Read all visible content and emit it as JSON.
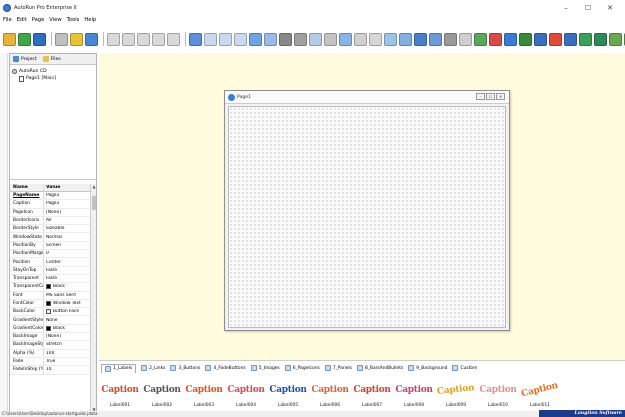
{
  "window": {
    "title": "AutoRun Pro Enterprise II",
    "minimize": "–",
    "maximize": "☐",
    "close": "✕"
  },
  "menu": [
    "File",
    "Edit",
    "Page",
    "View",
    "Tools",
    "Help"
  ],
  "toolbar_colors": [
    "#e8b33a",
    "#3fa64a",
    "#2f6fbf",
    "#bfbfbf",
    "#e8c23a",
    "#4a86d6",
    "#d9d9d9",
    "#d9d9d9",
    "#d9d9d9",
    "#d9d9d9",
    "#d9d9d9",
    "#5b8fd9",
    "#c9d9ef",
    "#c9d9ef",
    "#c9d9ef",
    "#6ea5e0",
    "#9bbbe6",
    "#888888",
    "#a0a0a0",
    "#b5c9e8",
    "#c4c4c4",
    "#8ab4e6",
    "#d0d0d0",
    "#d6d6d6",
    "#9cc5e8",
    "#7fb0e0",
    "#4a7fc8",
    "#6e9bd8",
    "#9a9a9a",
    "#cfcfcf",
    "#5ba75b",
    "#d94a4a",
    "#3b7bd6",
    "#3b8a3b",
    "#3a6fbf",
    "#e04a3a",
    "#3a6fbf",
    "#3aa05a",
    "#2e8b57",
    "#6aa84f",
    "#57a957"
  ],
  "left_panel": {
    "tabs": [
      {
        "label": "Project"
      },
      {
        "label": "Files"
      }
    ],
    "tree": {
      "root": "AutoRun CD",
      "child": "Page1 [Main]"
    }
  },
  "properties": {
    "header_name": "Name",
    "header_value": "Value",
    "rows": [
      {
        "name": "PageName",
        "value": "Page1"
      },
      {
        "name": "Caption",
        "value": "Page1"
      },
      {
        "name": "PageIcon",
        "value": "[None]"
      },
      {
        "name": "BorderIcons",
        "value": "All"
      },
      {
        "name": "BorderStyle",
        "value": "Sizeable"
      },
      {
        "name": "WindowState",
        "value": "Normal"
      },
      {
        "name": "PositionBy",
        "value": "Screen"
      },
      {
        "name": "PositionMargin",
        "value": "0"
      },
      {
        "name": "Position",
        "value": "Center"
      },
      {
        "name": "StayOnTop",
        "value": "False"
      },
      {
        "name": "Transparent",
        "value": "False"
      },
      {
        "name": "TransparentCol",
        "value": "Black"
      },
      {
        "name": "Font",
        "value": "MS Sans Serif"
      },
      {
        "name": "FontColor",
        "value": "Window Text"
      },
      {
        "name": "BackColor",
        "value": "Button Face"
      },
      {
        "name": "GradientStyle",
        "value": "None"
      },
      {
        "name": "GradientColor",
        "value": "Black"
      },
      {
        "name": "BackImage",
        "value": "[None]"
      },
      {
        "name": "BackImageStyle",
        "value": "Stretch"
      },
      {
        "name": "Alpha (%)",
        "value": "100"
      },
      {
        "name": "Fade",
        "value": "True"
      },
      {
        "name": "FadeInStep (%)",
        "value": "10"
      }
    ],
    "swatch_colors": {
      "TransparentCol": "#000000",
      "FontColor": "#000000",
      "BackColor": "#f0f0f0",
      "GradientColor": "#000000"
    }
  },
  "page_window": {
    "title": "Page1",
    "btn_min": "–",
    "btn_max": "☐",
    "btn_close": "✕"
  },
  "gallery_tabs": [
    "1_Labels",
    "2_Links",
    "3_Buttons",
    "4_FadeButtons",
    "5_Images",
    "6_PageIcons",
    "7_Panels",
    "8_BarsAndBullets",
    "9_Background",
    "Custom"
  ],
  "gallery": [
    {
      "caption": "Caption",
      "label": "Label001",
      "color": "#d84a2a"
    },
    {
      "caption": "Caption",
      "label": "Label002",
      "color": "#555555"
    },
    {
      "caption": "Caption",
      "label": "Label003",
      "color": "#e8501e"
    },
    {
      "caption": "Caption",
      "label": "Label004",
      "color": "#d94b4b"
    },
    {
      "caption": "Caption",
      "label": "Label005",
      "color": "#1f4fb5"
    },
    {
      "caption": "Caption",
      "label": "Label006",
      "color": "#e0603a"
    },
    {
      "caption": "Caption",
      "label": "Label007",
      "color": "#d8402a"
    },
    {
      "caption": "Caption",
      "label": "Label008",
      "color": "#c9406e"
    },
    {
      "caption": "Caption",
      "label": "Label009",
      "color": "#e0a020"
    },
    {
      "caption": "Caption",
      "label": "Label010",
      "color": "#e8908a"
    },
    {
      "caption": "Caption",
      "label": "Label011",
      "color": "#e07020"
    }
  ],
  "status": {
    "path": "C:\\Users\\User\\Desktop\\autorun-startguide.jdata",
    "brand": "Longtion Software"
  }
}
